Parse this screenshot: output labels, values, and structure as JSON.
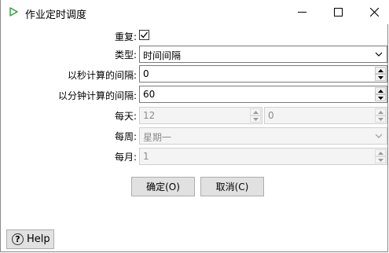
{
  "window": {
    "title": "作业定时调度"
  },
  "form": {
    "repeat": {
      "label": "重复:",
      "checked": true
    },
    "type": {
      "label": "类型:",
      "value": "时间间隔"
    },
    "interval_seconds": {
      "label": "以秒计算的间隔:",
      "value": "0"
    },
    "interval_minutes": {
      "label": "以分钟计算的间隔:",
      "value": "60"
    },
    "daily": {
      "label": "每天:",
      "hour": "12",
      "minute": "0"
    },
    "weekly": {
      "label": "每周:",
      "value": "星期一"
    },
    "monthly": {
      "label": "每月:",
      "value": "1"
    }
  },
  "buttons": {
    "ok": "确定(O)",
    "cancel": "取消(C)",
    "help": "Help"
  },
  "colors": {
    "app_icon": "#2e9e3a",
    "button_face": "#e1e1e1",
    "disabled_text": "#8c8c8c"
  }
}
